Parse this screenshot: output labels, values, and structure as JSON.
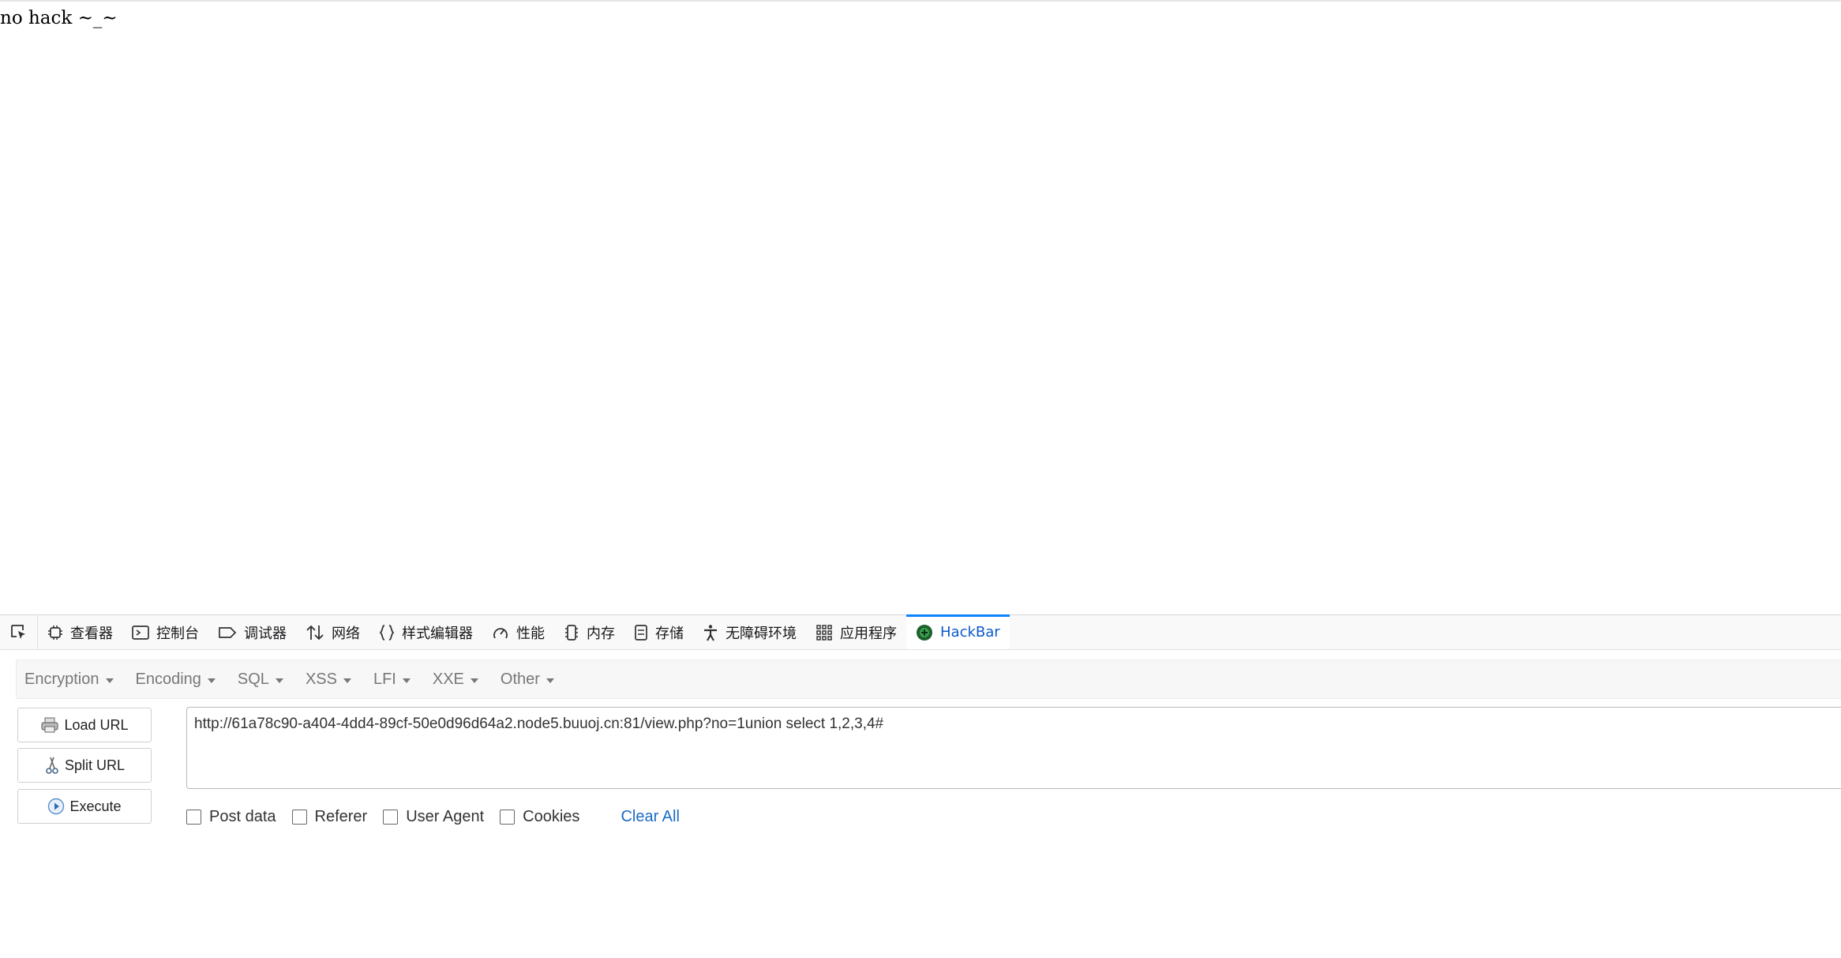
{
  "page": {
    "text": "no hack ~_~"
  },
  "devtools": {
    "tabs": [
      {
        "label": "查看器",
        "icon": "inspector-icon"
      },
      {
        "label": "控制台",
        "icon": "console-icon"
      },
      {
        "label": "调试器",
        "icon": "debugger-icon"
      },
      {
        "label": "网络",
        "icon": "network-icon"
      },
      {
        "label": "样式编辑器",
        "icon": "style-editor-icon"
      },
      {
        "label": "性能",
        "icon": "performance-icon"
      },
      {
        "label": "内存",
        "icon": "memory-icon"
      },
      {
        "label": "存储",
        "icon": "storage-icon"
      },
      {
        "label": "无障碍环境",
        "icon": "accessibility-icon"
      },
      {
        "label": "应用程序",
        "icon": "application-icon"
      },
      {
        "label": "HackBar",
        "icon": "hackbar-icon",
        "active": true
      }
    ]
  },
  "hackbar": {
    "menus": [
      "Encryption",
      "Encoding",
      "SQL",
      "XSS",
      "LFI",
      "XXE",
      "Other"
    ],
    "buttons": {
      "load": "Load URL",
      "split": "Split URL",
      "execute": "Execute"
    },
    "url": "http://61a78c90-a404-4dd4-89cf-50e0d96d64a2.node5.buuoj.cn:81/view.php?no=1union select 1,2,3,4#",
    "options": [
      "Post data",
      "Referer",
      "User Agent",
      "Cookies"
    ],
    "clear_all": "Clear All"
  },
  "colors": {
    "active_tab": "#0a84ff",
    "link": "#1a6bc4"
  }
}
